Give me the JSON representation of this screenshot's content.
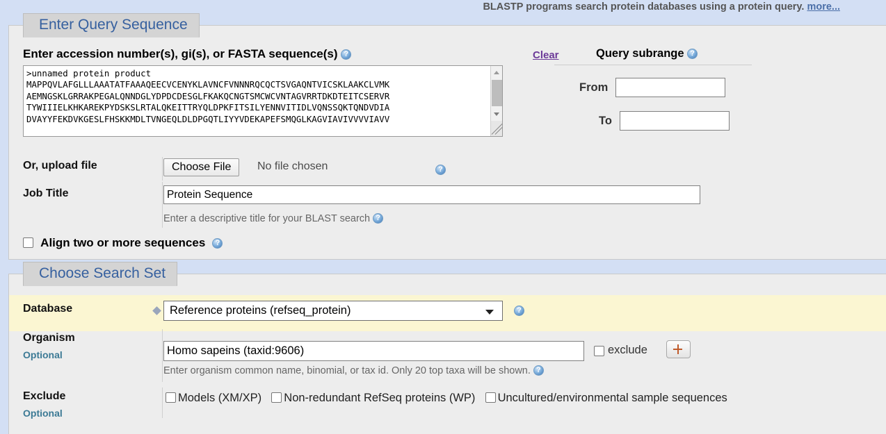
{
  "header": {
    "description": "BLASTP programs search protein databases using a protein query.",
    "more_link": "more..."
  },
  "query_section": {
    "tab_title": "Enter Query Sequence",
    "query_label": "Enter accession number(s), gi(s), or FASTA sequence(s)",
    "query_help_icon": "help-icon",
    "sequence_text": ">unnamed protein product\nMAPPQVLAFGLLLAAATATFAAAQEECVCENYKLAVNCFVNNNRQCQCTSVGAQNTVICSKLAAKCLVMK\nAEMNGSKLGRRAKPEGALQNNDGLYDPDCDESGLFKAKQCNGTSMCWCVNTAGVRRTDKDTEITCSERVR\nTYWIIIELKHKAREKPYDSKSLRTALQKEITTRYQLDPKFITSILYENNVITIDLVQNSSQKTQNDVDIA\nDVAYYFEKDVKGESLFHSKKMDLTVNGEQLDLDPGQTLIYYVDEKAPEFSMQGLKAGVIAVIVVVVIAVV",
    "clear_link": "Clear",
    "subrange_title": "Query subrange",
    "subrange_help_icon": "help-icon",
    "from_label": "From",
    "from_value": "",
    "to_label": "To",
    "to_value": "",
    "upload_label": "Or, upload file",
    "choose_file_button": "Choose File",
    "no_file_text": "No file chosen",
    "upload_help_icon": "help-icon",
    "job_title_label": "Job Title",
    "job_title_value": "Protein Sequence",
    "job_title_hint": "Enter a descriptive title for your BLAST search",
    "job_title_help_icon": "help-icon",
    "align_label": "Align two or more sequences",
    "align_checked": false,
    "align_help_icon": "help-icon"
  },
  "search_set_section": {
    "tab_title": "Choose Search Set",
    "database_label": "Database",
    "database_value": "Reference proteins (refseq_protein)",
    "database_marker_icon": "diamond-marker-icon",
    "database_caret_icon": "chevron-down-icon",
    "database_help_icon": "help-icon",
    "organism_label": "Organism",
    "organism_optional": "Optional",
    "organism_value": "Homo sapeins (taxid:9606)",
    "organism_exclude_label": "exclude",
    "organism_exclude_checked": false,
    "organism_add_button": "+",
    "organism_hint": "Enter organism common name, binomial, or tax id. Only 20 top taxa will be shown.",
    "organism_help_icon": "help-icon",
    "exclude_label": "Exclude",
    "exclude_optional": "Optional",
    "exclude_options": [
      {
        "label": "Models (XM/XP)",
        "checked": false
      },
      {
        "label": "Non-redundant RefSeq proteins (WP)",
        "checked": false
      },
      {
        "label": "Uncultured/environmental sample sequences",
        "checked": false
      }
    ]
  },
  "colors": {
    "page_background": "#d3dff4",
    "panel_background": "#ededed",
    "tab_background": "#d4d4d4",
    "tab_text": "#36609f",
    "highlight_row": "#fbf6d2",
    "link": "#4b6fa8",
    "visited_link": "#6c3a98",
    "optional_label": "#3c7a95"
  }
}
